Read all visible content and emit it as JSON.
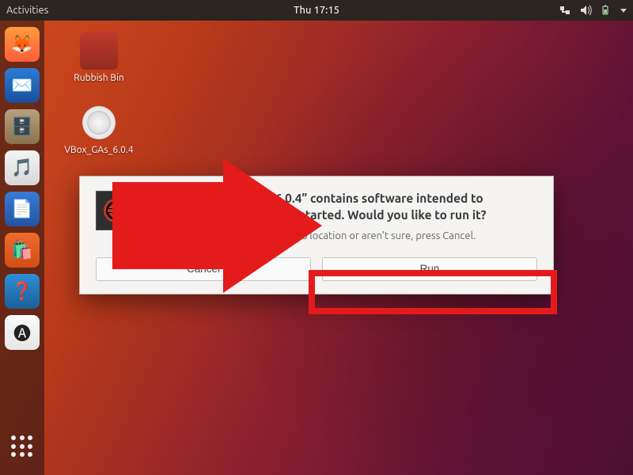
{
  "panel": {
    "activities": "Activities",
    "clock": "Thu 17:15"
  },
  "launcher": [
    {
      "name": "firefox",
      "glyph": "🦊"
    },
    {
      "name": "thunderbird",
      "glyph": "✉️"
    },
    {
      "name": "files",
      "glyph": "🗄️"
    },
    {
      "name": "rhythmbox",
      "glyph": "🎵"
    },
    {
      "name": "writer",
      "glyph": "📄"
    },
    {
      "name": "software",
      "glyph": "🛍️"
    },
    {
      "name": "help",
      "glyph": "❓"
    },
    {
      "name": "amazon",
      "glyph": "🅐"
    }
  ],
  "desktop": {
    "rubbish_label": "Rubbish Bin",
    "disc_label": "VBox_GAs_6.0.4"
  },
  "dialog": {
    "title_line1": "“VBox_GAs_6.0.4” contains software intended to",
    "title_line2": "be automatically started. Would you like to run it?",
    "subtext": "If you don't trust this location or aren't sure, press Cancel.",
    "cancel": "Cancel",
    "run": "Run"
  }
}
